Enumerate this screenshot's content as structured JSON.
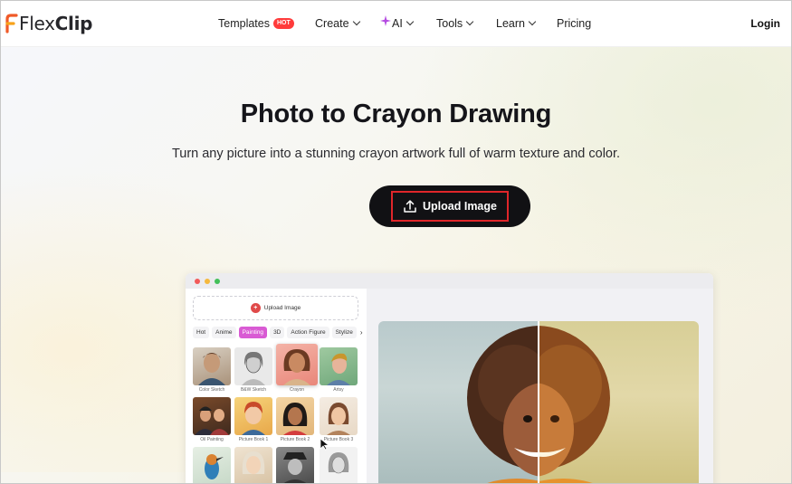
{
  "brand": {
    "name_prefix": "Flex",
    "name_suffix": "Clip",
    "accent_color": "#f05a28"
  },
  "nav": {
    "items": [
      {
        "label": "Templates",
        "badge": "HOT",
        "dropdown": false
      },
      {
        "label": "Create",
        "dropdown": true
      },
      {
        "label": "AI",
        "dropdown": true,
        "icon": "sparkle-icon"
      },
      {
        "label": "Tools",
        "dropdown": true
      },
      {
        "label": "Learn",
        "dropdown": true
      },
      {
        "label": "Pricing",
        "dropdown": false
      }
    ],
    "login_label": "Login"
  },
  "hero": {
    "title": "Photo to Crayon Drawing",
    "subtitle": "Turn any picture into a stunning crayon artwork full of warm texture and color.",
    "upload_button_label": "Upload Image",
    "upload_icon": "upload-icon",
    "highlight_color": "#e0262a"
  },
  "mockup": {
    "window_dots": [
      "#f25a5a",
      "#f5b83d",
      "#43c05a"
    ],
    "upload_label": "Upload Image",
    "style_tabs": [
      "Hot",
      "Anime",
      "Painting",
      "3D",
      "Action Figure",
      "Stylize"
    ],
    "active_tab": "Painting",
    "styles": [
      {
        "label": "Color Sketch"
      },
      {
        "label": "B&W Sketch"
      },
      {
        "label": "Crayon"
      },
      {
        "label": "Artsy"
      },
      {
        "label": "Oil Painting"
      },
      {
        "label": "Picture Book 1"
      },
      {
        "label": "Picture Book 2"
      },
      {
        "label": "Picture Book 3"
      },
      {
        "label": ""
      },
      {
        "label": ""
      },
      {
        "label": ""
      },
      {
        "label": ""
      }
    ],
    "selected_style": "Crayon",
    "active_tab_color": "#d95bd4"
  }
}
